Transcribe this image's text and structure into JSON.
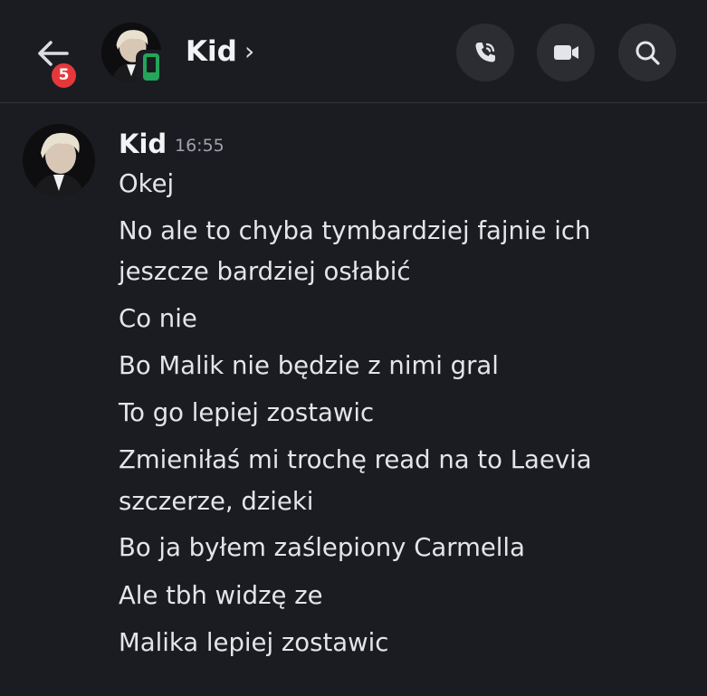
{
  "header": {
    "notification_count": "5",
    "contact_name": "Kid",
    "chevron": "›",
    "status": "mobile",
    "icons": [
      "arrow-left-icon",
      "phone-call-icon",
      "video-camera-icon",
      "search-icon"
    ]
  },
  "message": {
    "author": "Kid",
    "time": "16:55",
    "lines": [
      "Okej",
      "No ale to chyba tymbardziej fajnie ich",
      "jeszcze bardziej osłabić",
      "Co nie",
      "Bo Malik nie będzie z nimi gral",
      "To go lepiej zostawic",
      "Zmieniłaś mi trochę read na to Laevia",
      "szczerze, dzieki",
      "Bo ja byłem zaślepiony Carmella",
      "Ale tbh widzę ze",
      "Malika lepiej zostawic"
    ]
  },
  "colors": {
    "background": "#1b1c21",
    "badge": "#e5383b",
    "online_mobile": "#23a55a",
    "button_bg": "#2b2d33",
    "text": "#e3e5e8",
    "muted": "#a0a3ab"
  }
}
